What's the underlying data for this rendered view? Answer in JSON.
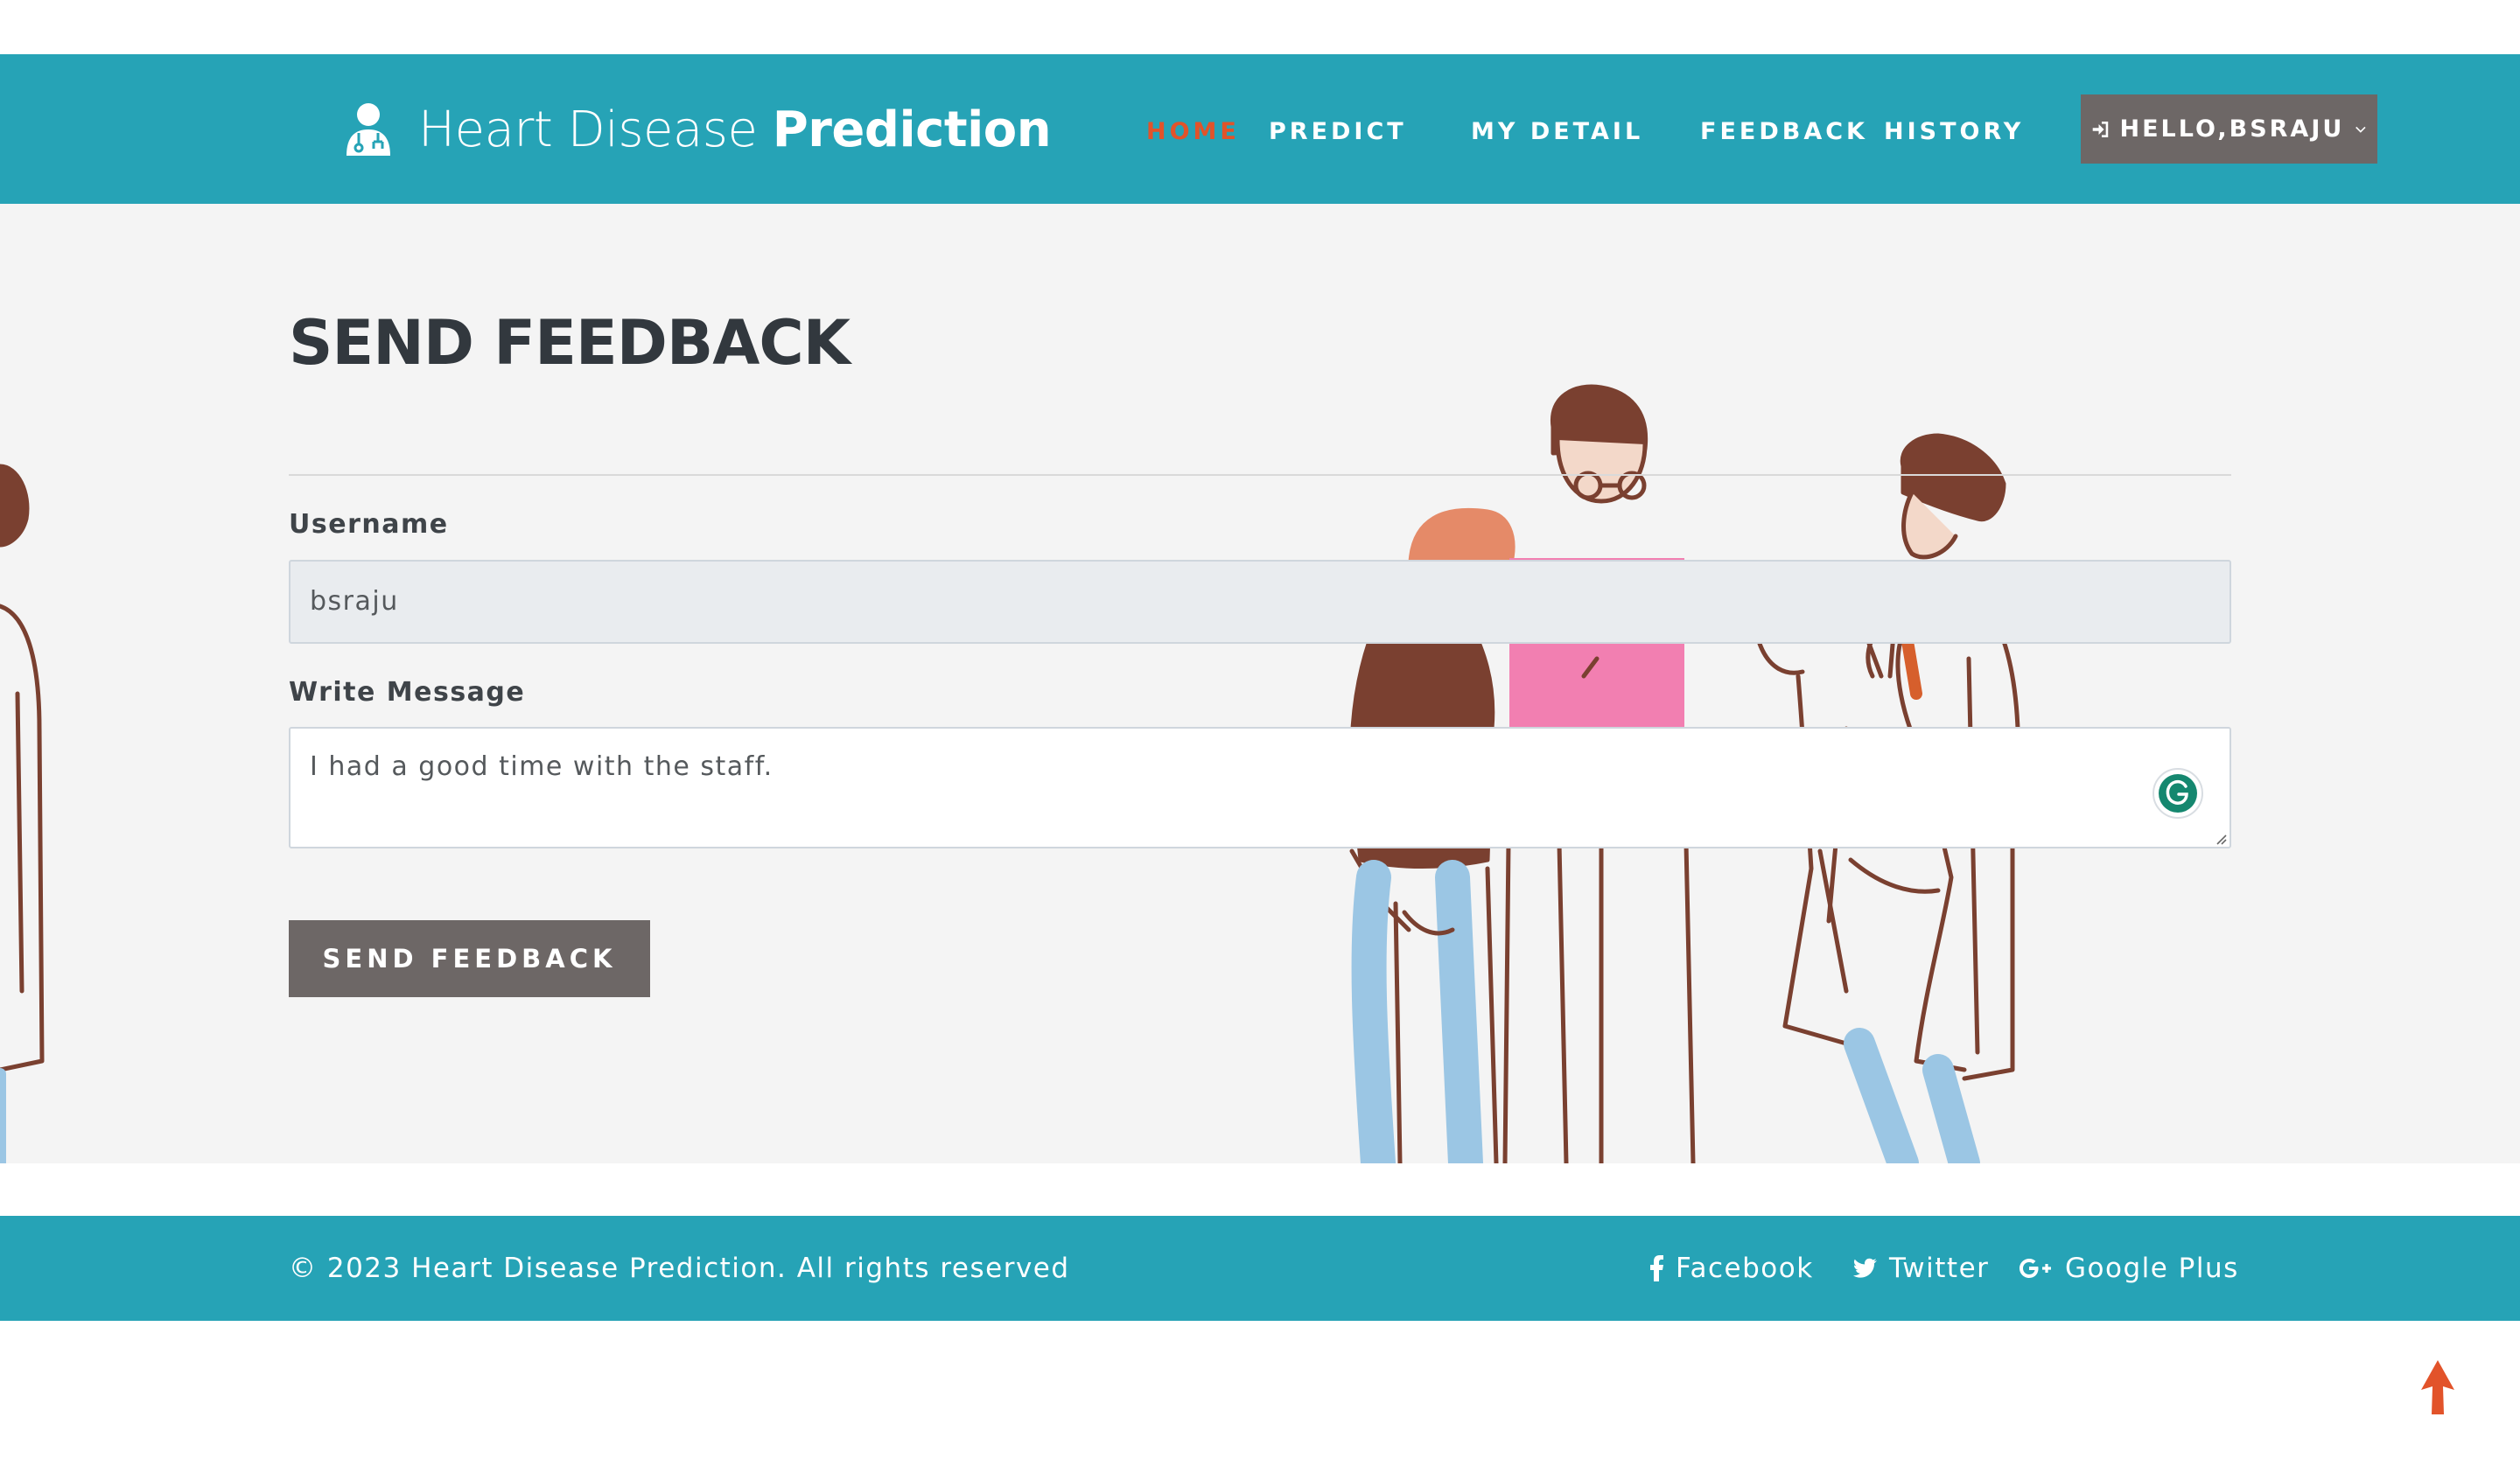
{
  "header": {
    "brand_light": "Heart Disease ",
    "brand_bold": "Prediction",
    "brand_icon": "doctor-icon",
    "nav": [
      {
        "label": "HOME",
        "active": true
      },
      {
        "label": "PREDICT",
        "active": false
      },
      {
        "label": "MY DETAIL",
        "active": false
      },
      {
        "label": "FEEDBACK",
        "active": false
      },
      {
        "label": "HISTORY",
        "active": false
      }
    ],
    "user_menu": {
      "label": "HELLO,BSRAJU",
      "icon": "sign-in-icon",
      "caret": "chevron-down-icon"
    }
  },
  "main": {
    "title": "SEND FEEDBACK",
    "username_label": "Username",
    "username_value": "bsraju",
    "message_label": "Write Message",
    "message_value": "I had a good time with the staff.",
    "submit_label": "SEND FEEDBACK"
  },
  "footer": {
    "copyright": "© 2023 Heart Disease Prediction. All rights reserved",
    "social": [
      {
        "label": "Facebook",
        "icon": "facebook-icon"
      },
      {
        "label": "Twitter",
        "icon": "twitter-icon"
      },
      {
        "label": "Google Plus",
        "icon": "google-plus-icon"
      }
    ]
  },
  "colors": {
    "header_bg": "#26a3b6",
    "accent": "#e2532a",
    "button_bg": "#6d6766",
    "main_bg": "#f4f4f4",
    "title_text": "#32383e"
  }
}
